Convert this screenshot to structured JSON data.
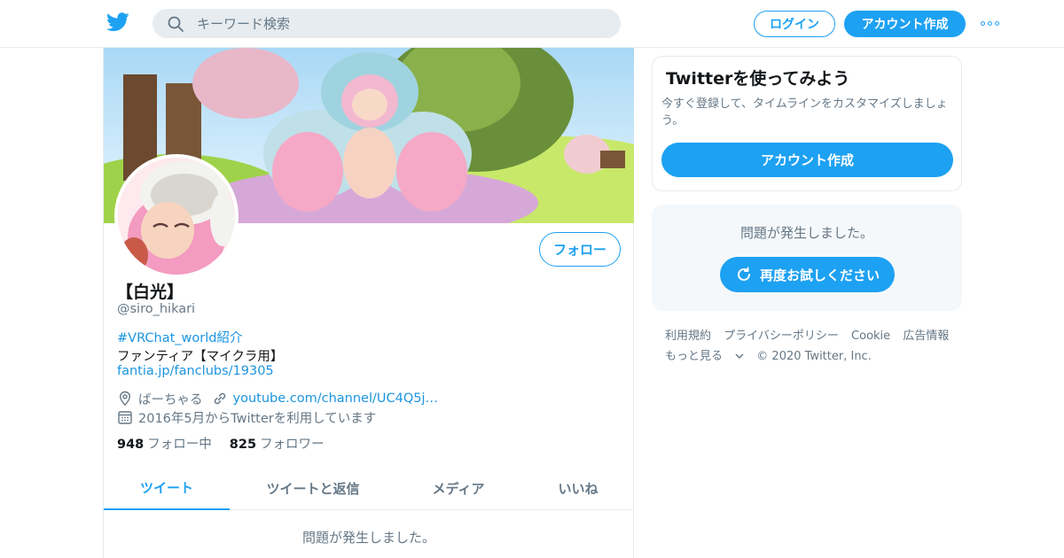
{
  "header": {
    "search_placeholder": "キーワード検索",
    "login_label": "ログイン",
    "signup_label": "アカウント作成",
    "icons": {
      "logo": "twitter-bird-icon",
      "search": "search-icon",
      "more": "more-dots-icon"
    },
    "accent_color": "#1da1f2"
  },
  "profile": {
    "name": "【白光】",
    "handle": "@siro_hikari",
    "follow_label": "フォロー",
    "bio_hashtag": "#VRChat_world紹介",
    "bio_line2": "ファンティア【マイクラ用】",
    "bio_link": "fantia.jp/fanclubs/19305",
    "location": "ばーちゃる",
    "website": "youtube.com/channel/UC4Q5j…",
    "joined": "2016年5月からTwitterを利用しています",
    "following_count": "948",
    "following_label": "フォロー中",
    "followers_count": "825",
    "followers_label": "フォロワー"
  },
  "tabs": [
    {
      "label": "ツイート",
      "active": true
    },
    {
      "label": "ツイートと返信",
      "active": false
    },
    {
      "label": "メディア",
      "active": false
    },
    {
      "label": "いいね",
      "active": false
    }
  ],
  "timeline": {
    "error_message": "問題が発生しました。"
  },
  "sidebar": {
    "signup_card": {
      "title": "Twitterを使ってみよう",
      "description": "今すぐ登録して、タイムラインをカスタマイズしましょう。",
      "button_label": "アカウント作成"
    },
    "error_card": {
      "message": "問題が発生しました。",
      "retry_label": "再度お試しください"
    },
    "footer": {
      "links": [
        "利用規約",
        "プライバシーポリシー",
        "Cookie",
        "広告情報"
      ],
      "more_label": "もっと見る",
      "copyright": "© 2020 Twitter, Inc."
    }
  }
}
